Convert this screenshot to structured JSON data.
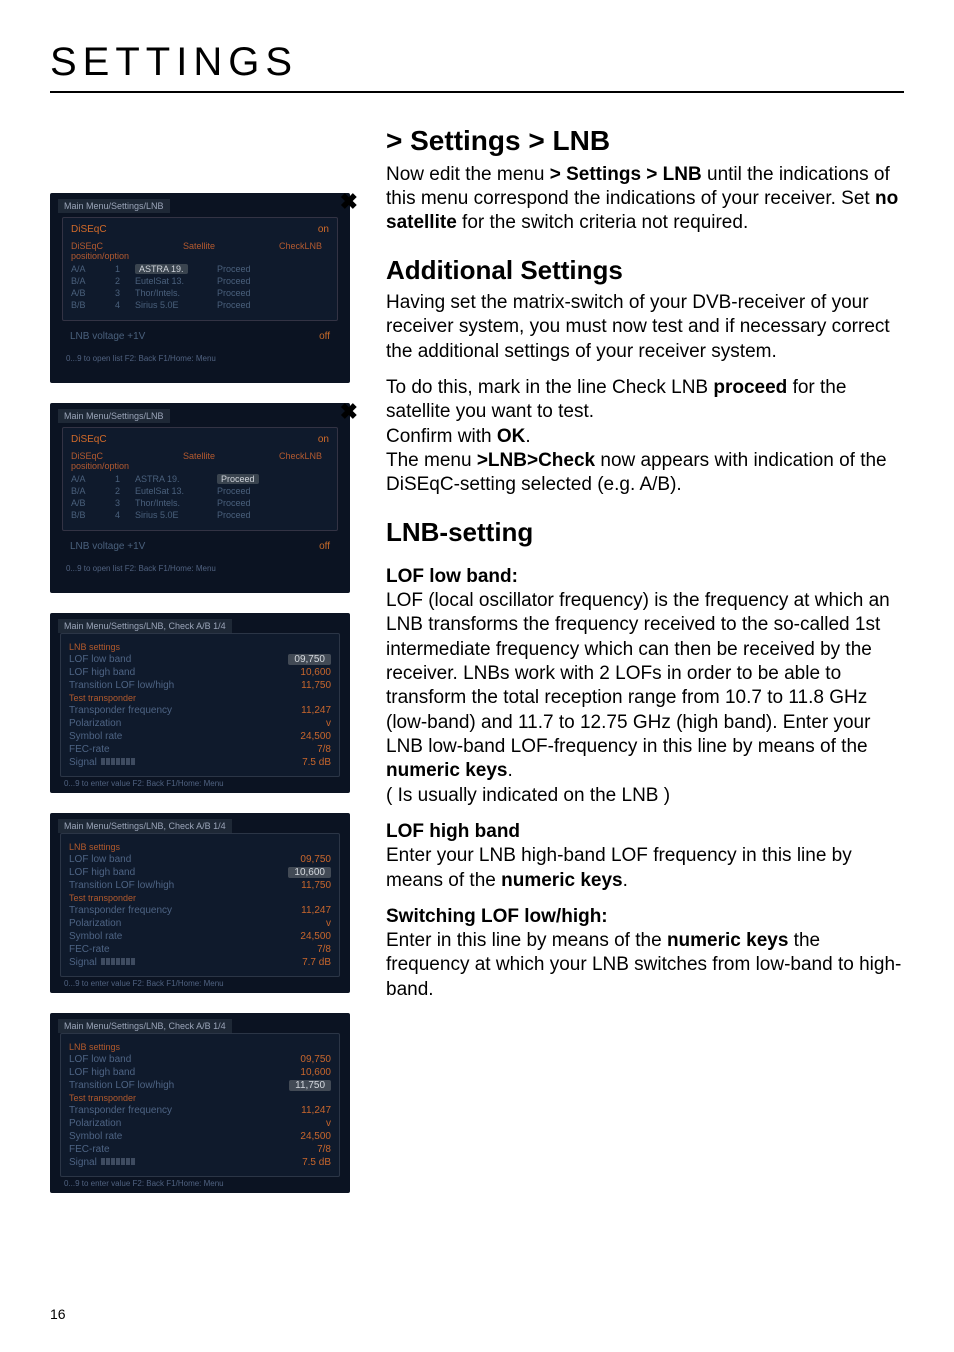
{
  "page": {
    "title": "SETTINGS",
    "number": "16"
  },
  "breadcrumb": "> Settings > LNB",
  "para": {
    "intro1": "Now edit the menu  ",
    "intro1b": "> Settings > LNB",
    "intro1c": " until the indications of this menu correspond the indications of your receiver. Set  ",
    "intro1d": "no satellite",
    "intro1e": " for the switch criteria not required.",
    "addl_heading": "Additional Settings",
    "addl_p": "Having set the matrix-switch of your DVB-receiver of your receiver system, you must now test and if necessary correct the additional settings of your receiver system.",
    "todo_a": "To do this, mark in the line Check LNB ",
    "todo_b": "proceed",
    "todo_c": " for the satellite you want to test.",
    "confirm_a": "Confirm with ",
    "confirm_b": "OK",
    "confirm_c": ".",
    "menu_a": "The menu ",
    "menu_b": ">LNB>Check",
    "menu_c": " now appears with indication of the  DiSEqC-setting selected (e.g. A/B).",
    "lnb_heading": "LNB-setting",
    "lof_low_h": "LOF low band:",
    "lof_low_p1": "LOF (local oscillator frequency) is the frequency at which an LNB transforms the frequency received to the so-called 1st intermediate frequency which can then be received by the receiver. LNBs work with 2 LOFs in order to be able to transform the total reception range from  10.7 to 11.8 GHz (low-band) and 11.7 to 12.75 GHz (high band). Enter your LNB low-band LOF-frequency in this line by means of the ",
    "numeric_keys": "numeric keys",
    "lof_low_p1b": ".",
    "lof_low_p2": "( Is usually indicated on the LNB )",
    "lof_high_h": "LOF high band",
    "lof_high_p_a": "Enter your LNB high-band LOF frequency in this line by means of the ",
    "lof_high_p_b": ".",
    "switch_h": "Switching LOF low/high:",
    "switch_p_a": "Enter in this line by means of the ",
    "switch_p_b": " the frequency at which your LNB switches from low-band to high-band."
  },
  "shots": {
    "diseqc_ribbon": "Main Menu/Settings/LNB",
    "diseqc_head_left": "DiSEqC",
    "diseqc_head_right": "on",
    "diseqc_hrow": "DiSEqC  position/option",
    "cols": {
      "sat": "Satellite",
      "check": "CheckLNB"
    },
    "rows": [
      {
        "pos": "A/A",
        "n": "1",
        "sat": "ASTRA 19.",
        "check": "Proceed"
      },
      {
        "pos": "B/A",
        "n": "2",
        "sat": "EutelSat 13.",
        "check": "Proceed"
      },
      {
        "pos": "A/B",
        "n": "3",
        "sat": "Thor/Intels.",
        "check": "Proceed"
      },
      {
        "pos": "B/B",
        "n": "4",
        "sat": "Sirius 5.0E",
        "check": "Proceed"
      }
    ],
    "footer_left": "LNB voltage +1V",
    "footer_right": "off",
    "bottom": "0...9 to open list  F2: Back  F1/Home: Menu",
    "lnb_ribbon": "Main Menu/Settings/LNB, Check A/B 1/4",
    "lnb_sect1": "LNB settings",
    "lnb_rows": {
      "low": "LOF low band",
      "high": "LOF high band",
      "trans": "Transition LOF low/high",
      "sect2": "Test transponder",
      "freq": "Transponder frequency",
      "pol": "Polarization",
      "sym": "Symbol rate",
      "fec": "FEC-rate",
      "signal": "Signal"
    },
    "lnb_vals": {
      "low": "09,750",
      "high": "10,600",
      "trans": "11,750",
      "freq": "11,247",
      "pol": "v",
      "sym": "24,500",
      "fec": "7/8",
      "signal": "7.5 dB",
      "high_box": "10,600",
      "trans_box": "11,750",
      "signal2": "7.7 dB"
    },
    "lnb_bottom": "0...9 to enter value  F2: Back  F1/Home: Menu"
  }
}
